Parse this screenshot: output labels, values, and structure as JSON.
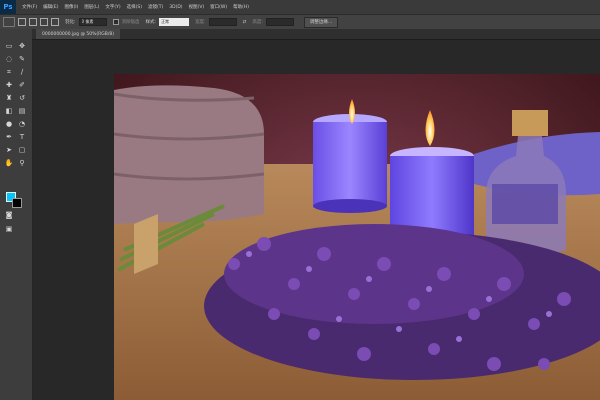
{
  "app": {
    "logo": "Ps"
  },
  "menu": [
    "文件(F)",
    "编辑(E)",
    "图像(I)",
    "图层(L)",
    "文字(Y)",
    "选择(S)",
    "滤镜(T)",
    "3D(D)",
    "视图(V)",
    "窗口(W)",
    "帮助(H)"
  ],
  "options": {
    "feather_label": "羽化:",
    "feather_value": "0 像素",
    "antialias_label": "消除锯齿",
    "style_label": "样式:",
    "style_value": "正常",
    "width_label": "宽度:",
    "height_label": "高度:",
    "refine_button": "调整边缘..."
  },
  "document": {
    "tab_title": "0000000000.jpg @ 50%(RGB/8)"
  },
  "colors": {
    "foreground": "#00c8ff",
    "background": "#000000"
  }
}
